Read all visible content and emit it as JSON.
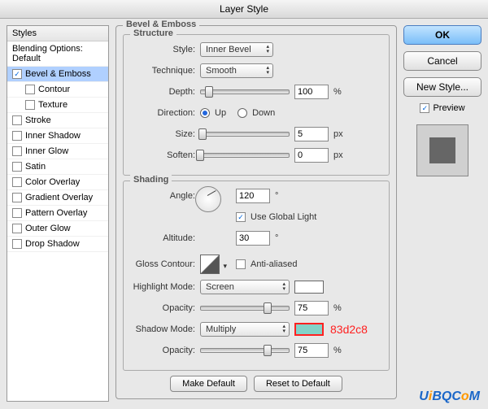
{
  "title": "Layer Style",
  "styles_panel": {
    "header": "Styles",
    "blend": "Blending Options: Default",
    "bevel": "Bevel & Emboss",
    "contour": "Contour",
    "texture": "Texture",
    "stroke": "Stroke",
    "inner_shadow": "Inner Shadow",
    "inner_glow": "Inner Glow",
    "satin": "Satin",
    "color_overlay": "Color Overlay",
    "gradient_overlay": "Gradient Overlay",
    "pattern_overlay": "Pattern Overlay",
    "outer_glow": "Outer Glow",
    "drop_shadow": "Drop Shadow"
  },
  "main": {
    "legend": "Bevel & Emboss",
    "structure": {
      "legend": "Structure",
      "style_label": "Style:",
      "style_value": "Inner Bevel",
      "technique_label": "Technique:",
      "technique_value": "Smooth",
      "depth_label": "Depth:",
      "depth_value": "100",
      "depth_unit": "%",
      "direction_label": "Direction:",
      "up": "Up",
      "down": "Down",
      "size_label": "Size:",
      "size_value": "5",
      "size_unit": "px",
      "soften_label": "Soften:",
      "soften_value": "0",
      "soften_unit": "px"
    },
    "shading": {
      "legend": "Shading",
      "angle_label": "Angle:",
      "angle_value": "120",
      "use_global": "Use Global Light",
      "altitude_label": "Altitude:",
      "altitude_value": "30",
      "gloss_label": "Gloss Contour:",
      "anti_aliased": "Anti-aliased",
      "highlight_label": "Highlight Mode:",
      "highlight_value": "Screen",
      "h_opacity_label": "Opacity:",
      "h_opacity_value": "75",
      "shadow_label": "Shadow Mode:",
      "shadow_value": "Multiply",
      "shadow_color_anno": "83d2c8",
      "s_opacity_label": "Opacity:",
      "s_opacity_value": "75",
      "pct": "%"
    },
    "make_default": "Make Default",
    "reset_default": "Reset to Default"
  },
  "right": {
    "ok": "OK",
    "cancel": "Cancel",
    "new_style": "New Style...",
    "preview": "Preview"
  },
  "logo": {
    "u": "U",
    "i": "i",
    "b": "B",
    "q": "Q",
    ".": ".",
    "c": "C",
    "o": "o",
    "m": "M"
  }
}
